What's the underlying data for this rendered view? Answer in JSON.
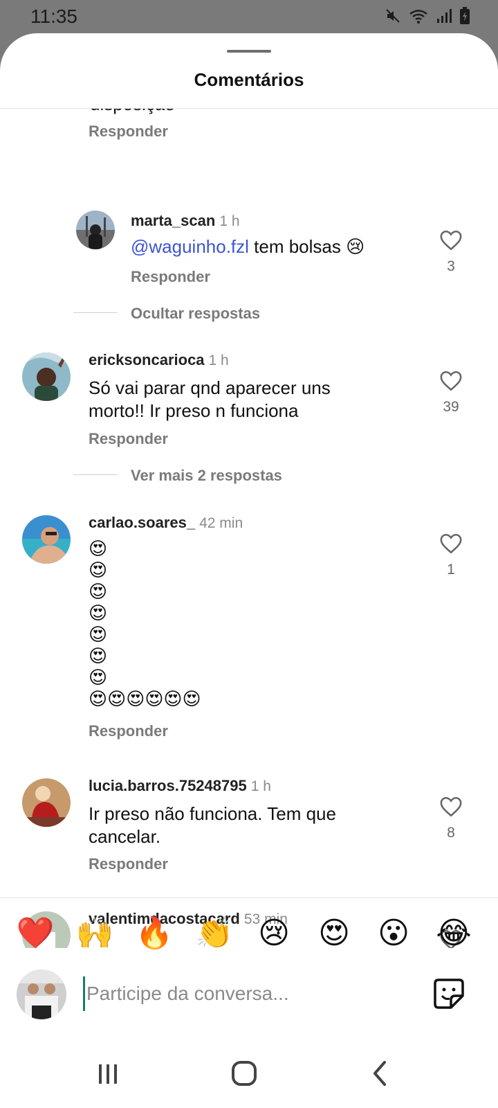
{
  "status_bar": {
    "time": "11:35"
  },
  "sheet": {
    "title": "Comentários"
  },
  "cut_comment": {
    "text": "disposição",
    "reply_label": "Responder"
  },
  "comments": [
    {
      "username": "marta_scan",
      "time": "1 h",
      "mention": "@waguinho.fzl",
      "text": " tem bolsas 😢",
      "reply_label": "Responder",
      "likes": "3"
    },
    {
      "username": "ericksoncarioca",
      "time": "1 h",
      "text": "Só vai parar qnd aparecer uns morto!! Ir preso n funciona",
      "reply_label": "Responder",
      "likes": "39"
    },
    {
      "username": "carlao.soares_",
      "time": "42 min",
      "emoji_lines": [
        "😍",
        "😍",
        "😍",
        "😍",
        "😍",
        "😍",
        "😍",
        "😍😍😍😍😍😍"
      ],
      "reply_label": "Responder",
      "likes": "1"
    },
    {
      "username": "lucia.barros.75248795",
      "time": "1 h",
      "text": "Ir preso não  funciona. Tem que cancelar.",
      "reply_label": "Responder",
      "likes": "8"
    },
    {
      "username": "valentimdacostacard",
      "time": "53 min"
    }
  ],
  "threads": {
    "hide_replies": "Ocultar respostas",
    "more_replies": "Ver mais 2 respostas"
  },
  "emoji_bar": [
    "❤️",
    "🙌",
    "🔥",
    "👏",
    "😢",
    "😍",
    "😮",
    "😂"
  ],
  "composer": {
    "placeholder": "Participe da conversa..."
  },
  "colors": {
    "mention": "#3b54d6",
    "cursor": "#1b7a6a",
    "secondary_text": "#7a7a7a"
  }
}
